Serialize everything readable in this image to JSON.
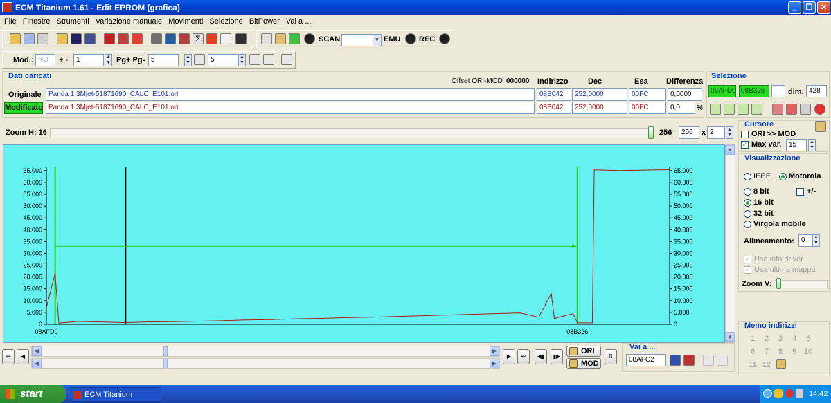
{
  "window": {
    "title": "ECM Titanium 1.61 - Edit EPROM (grafica)"
  },
  "menu": [
    "File",
    "Finestre",
    "Strumenti",
    "Variazione manuale",
    "Movimenti",
    "Selezione",
    "BitPower",
    "Vai a ..."
  ],
  "toolbar1": {
    "scan_label": "SCAN",
    "emu_label": "EMU",
    "rec_label": "REC",
    "scan_select_value": ""
  },
  "toolbar2": {
    "mod_label": "Mod.:",
    "mod_value": "NO",
    "step_label": "+ -",
    "step_value": "1",
    "pg_label": "Pg+ Pg-",
    "pg_value": "5",
    "t_value": "5"
  },
  "data": {
    "title": "Dati caricati",
    "offset_label": "Offset ORI-MOD",
    "offset_value": "000000",
    "headers": [
      "Indirizzo",
      "Dec",
      "Esa",
      "Differenza"
    ],
    "original": {
      "label": "Originale",
      "file": "Panda 1.3Mjet-51871690_CALC_E101.ori",
      "address": "08B042",
      "dec": "252,0000",
      "hex": "00FC",
      "diff": "0,0000"
    },
    "modified": {
      "label": "Modificato",
      "file": "Panda 1.3Mjet-51871690_CALC_E101.ori",
      "address": "08B042",
      "dec": "252,0000",
      "hex": "00FC",
      "diff": "0,0",
      "unit": "%"
    }
  },
  "selection": {
    "title": "Selezione",
    "start": "08AFD0",
    "end": "08B326",
    "dim_label": "dim.",
    "dim_value": "428"
  },
  "zoom": {
    "label": "Zoom H: 16",
    "value1": "256",
    "value2": "256",
    "mult": "x",
    "factor": "2"
  },
  "cursor": {
    "title": "Cursore",
    "ori_mod_label": "ORI >> MOD",
    "maxvar_label": "Max var.",
    "maxvar_value": "15"
  },
  "visual": {
    "title": "Visualizzazione",
    "ieee": "IEEE",
    "motorola": "Motorola",
    "bit8": "8 bit",
    "signed": "+/-",
    "bit16": "16 bit",
    "bit32": "32 bit",
    "float": "Virgola mobile",
    "align_label": "Allineamento:",
    "align_value": "0",
    "driver_info": "Usa info driver",
    "last_map": "Usa ultima mappa",
    "zoomv_label": "Zoom V:"
  },
  "memo": {
    "title": "Memo indirizzi",
    "numbers": [
      "1",
      "2",
      "3",
      "4",
      "5",
      "6",
      "7",
      "8",
      "9",
      "10",
      "11",
      "12"
    ]
  },
  "nav": {
    "ori_label": "ORI",
    "mod_label": "MOD",
    "goto_title": "Vai a ...",
    "goto_value": "08AFC2"
  },
  "chart_data": {
    "type": "line",
    "y_ticks": [
      "0",
      "5.000",
      "10.000",
      "15.000",
      "20.000",
      "25.000",
      "30.000",
      "35.000",
      "40.000",
      "45.000",
      "50.000",
      "55.000",
      "60.000",
      "65.000"
    ],
    "ylim": [
      0,
      65535
    ],
    "x_labels": [
      {
        "text": "08AFD0",
        "pos": 0
      },
      {
        "text": "08B326",
        "pos": 0.852
      }
    ],
    "marker_green_start": 0.014,
    "marker_black": 0.127,
    "marker_green_end": 0.852,
    "series": [
      {
        "color": "#b01818",
        "points": [
          [
            0,
            7000
          ],
          [
            0.014,
            21500
          ],
          [
            0.02,
            500
          ],
          [
            0.05,
            1200
          ],
          [
            0.1,
            900
          ],
          [
            0.127,
            700
          ],
          [
            0.16,
            1000
          ],
          [
            0.2,
            1100
          ],
          [
            0.24,
            1300
          ],
          [
            0.28,
            1500
          ],
          [
            0.32,
            1800
          ],
          [
            0.36,
            2000
          ],
          [
            0.4,
            2300
          ],
          [
            0.44,
            2500
          ],
          [
            0.48,
            2800
          ],
          [
            0.52,
            3000
          ],
          [
            0.56,
            3300
          ],
          [
            0.6,
            3600
          ],
          [
            0.64,
            3900
          ],
          [
            0.68,
            4200
          ],
          [
            0.72,
            4500
          ],
          [
            0.76,
            4800
          ],
          [
            0.79,
            3000
          ],
          [
            0.81,
            13000
          ],
          [
            0.815,
            2500
          ],
          [
            0.845,
            4500
          ],
          [
            0.852,
            600
          ],
          [
            0.876,
            600
          ],
          [
            0.879,
            65300
          ],
          [
            0.92,
            65000
          ],
          [
            0.96,
            65200
          ],
          [
            1.0,
            65400
          ]
        ]
      }
    ],
    "selection_arrow_y": 33000
  },
  "taskbar": {
    "start_label": "start",
    "task_label": "ECM Titanium",
    "clock": "14.42"
  }
}
